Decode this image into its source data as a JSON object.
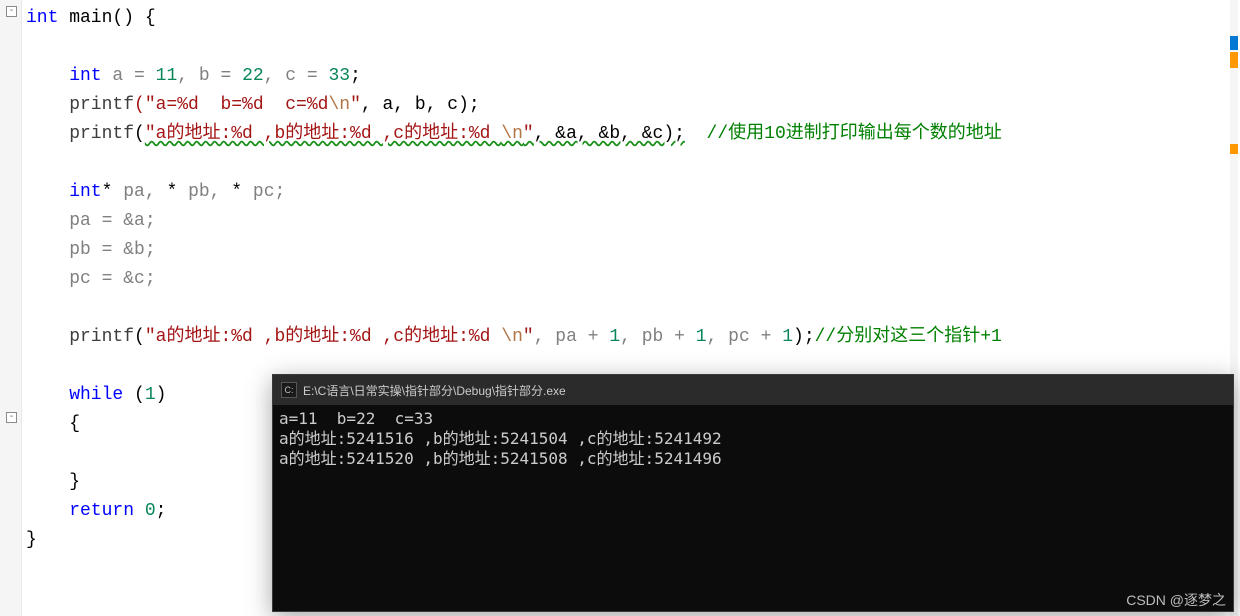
{
  "code": {
    "l1_int": "int",
    "l1_main": " main() {",
    "l3_int": "    int",
    "l3_rest": " a = ",
    "l3_11": "11",
    "l3_c1": ", b = ",
    "l3_22": "22",
    "l3_c2": ", c = ",
    "l3_33": "33",
    "l3_semi": ";",
    "l4_pf": "    printf",
    "l4_s1": "(\"a=%d  b=%d  c=%d",
    "l4_esc": "\\n",
    "l4_s1b": "\"",
    "l4_rest": ", a, b, c);",
    "l5_pf": "    printf",
    "l5_open": "(",
    "l5_str": "\"a的地址:%d ,b的地址:%d ,c的地址:%d ",
    "l5_esc": "\\n",
    "l5_strb": "\"",
    "l5_args": ", &a, &b, &c);",
    "l5_cmt": "  //使用10进制打印输出每个数的地址",
    "l7_int": "    int",
    "l7_star": "*",
    "l7_rest": " pa, ",
    "l7_star2": "*",
    "l7_rest2": " pb, ",
    "l7_star3": "*",
    "l7_rest3": " pc;",
    "l8": "    pa = &a;",
    "l9": "    pb = &b;",
    "l10": "    pc = &c;",
    "l12_pf": "    printf",
    "l12_open": "(",
    "l12_str": "\"a的地址:%d ,b的地址:%d ,c的地址:%d ",
    "l12_esc": "\\n",
    "l12_strb": "\"",
    "l12_args": ", pa + ",
    "l12_n1": "1",
    "l12_c1": ", pb + ",
    "l12_n2": "1",
    "l12_c2": ", pc + ",
    "l12_n3": "1",
    "l12_end": ");",
    "l12_cmt": "//分别对这三个指针+1",
    "l14_while": "    while",
    "l14_sp": " (",
    "l14_1": "1",
    "l14_close": ")",
    "l15": "    {",
    "l17": "    }",
    "l18_ret": "    return ",
    "l18_0": "0",
    "l18_semi": ";",
    "l19": "}"
  },
  "console": {
    "title": "E:\\C语言\\日常实操\\指针部分\\Debug\\指针部分.exe",
    "line1": "a=11  b=22  c=33",
    "line2": "a的地址:5241516 ,b的地址:5241504 ,c的地址:5241492",
    "line3": "a的地址:5241520 ,b的地址:5241508 ,c的地址:5241496"
  },
  "watermark": "CSDN @逐梦之"
}
